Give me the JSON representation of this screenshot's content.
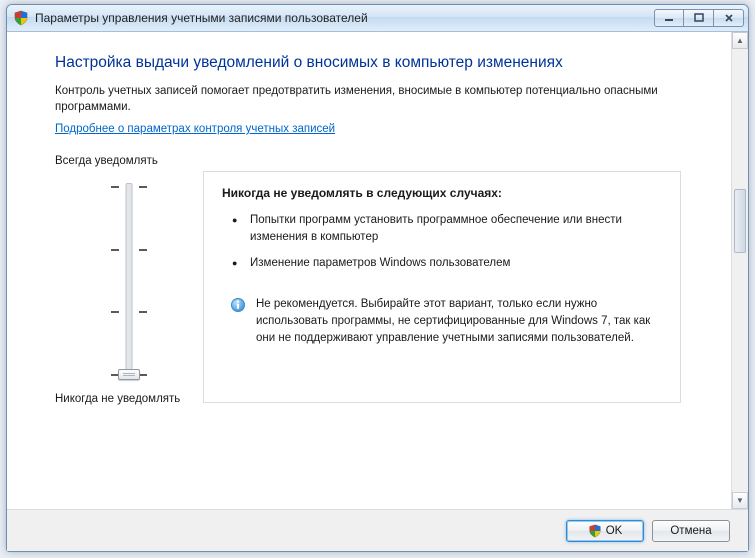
{
  "titlebar": {
    "title": "Параметры управления учетными записями пользователей"
  },
  "content": {
    "heading": "Настройка выдачи уведомлений о вносимых в компьютер изменениях",
    "description": "Контроль учетных записей помогает предотвратить изменения, вносимые в компьютер потенциально опасными программами.",
    "learn_more": "Подробнее о параметрах контроля учетных записей"
  },
  "slider": {
    "top_label": "Всегда уведомлять",
    "bottom_label": "Никогда не уведомлять"
  },
  "panel": {
    "title": "Никогда не уведомлять в следующих случаях:",
    "bullets": [
      "Попытки программ установить программное обеспечение или внести изменения в компьютер",
      "Изменение параметров Windows пользователем"
    ],
    "warning": "Не рекомендуется. Выбирайте этот вариант, только если нужно использовать программы, не сертифицированные для Windows 7, так как они не поддерживают управление учетными записями пользователей."
  },
  "footer": {
    "ok": "OK",
    "cancel": "Отмена"
  }
}
